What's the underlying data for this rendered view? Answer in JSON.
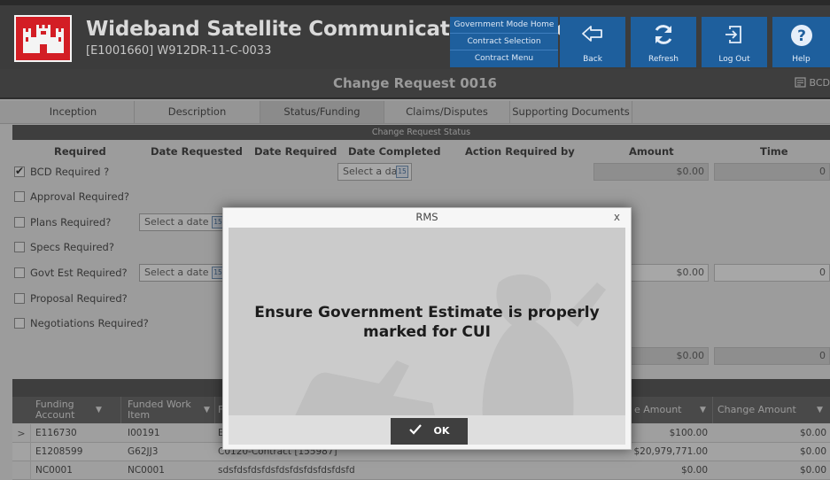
{
  "header": {
    "app_title": "Wideband Satellite Communications Center",
    "subtitle": "[E1001660] W912DR-11-C-0033",
    "mode_links": [
      "Government Mode Home",
      "Contract Selection",
      "Contract Menu"
    ],
    "buttons": [
      {
        "label": "Back",
        "icon": "back-arrow-icon"
      },
      {
        "label": "Refresh",
        "icon": "refresh-icon"
      },
      {
        "label": "Log Out",
        "icon": "logout-icon"
      },
      {
        "label": "Help",
        "icon": "help-icon"
      }
    ]
  },
  "page": {
    "title": "Change Request 0016",
    "bcd_link": "BCD"
  },
  "tabs": [
    "Inception",
    "Description",
    "Status/Funding",
    "Claims/Disputes",
    "Supporting Documents"
  ],
  "active_tab": "Status/Funding",
  "status": {
    "section_title": "Change Request Status",
    "columns": [
      "Required",
      "Date Requested",
      "Date Required",
      "Date Completed",
      "Action Required by",
      "Amount",
      "Time"
    ],
    "date_placeholder": "Select a date",
    "calendar_day": "15",
    "rows": [
      {
        "label": "BCD Required ?",
        "checked": true,
        "amount": "$0.00",
        "time": "0"
      },
      {
        "label": "Approval Required?",
        "checked": false
      },
      {
        "label": "Plans Required?",
        "checked": false
      },
      {
        "label": "Specs Required?",
        "checked": false
      },
      {
        "label": "Govt Est Required?",
        "checked": false,
        "amount": "$0.00",
        "time": "0"
      },
      {
        "label": "Proposal Required?",
        "checked": false
      },
      {
        "label": "Negotiations Required?",
        "checked": false
      }
    ],
    "total_amount": "$0.00",
    "total_time": "0"
  },
  "grid": {
    "columns": [
      "Funding Account",
      "Funded Work Item",
      "F",
      "e Amount",
      "Change Amount"
    ],
    "rows": [
      {
        "expander": ">",
        "account": "E116730",
        "work_item": "I00191",
        "desc": "E",
        "amount": "$100.00",
        "change": "$0.00"
      },
      {
        "expander": "",
        "account": "E1208599",
        "work_item": "G62JJ3",
        "desc": "C0120-Contract [155987]",
        "amount": "$20,979,771.00",
        "change": "$0.00"
      },
      {
        "expander": "",
        "account": "NC0001",
        "work_item": "NC0001",
        "desc": "sdsfdsfdsfdsfdsfdsfdsfdsfdsfd",
        "amount": "$0.00",
        "change": "$0.00"
      }
    ]
  },
  "modal": {
    "title": "RMS",
    "close": "x",
    "message": "Ensure Government Estimate is properly marked for CUI",
    "ok_label": "OK"
  }
}
